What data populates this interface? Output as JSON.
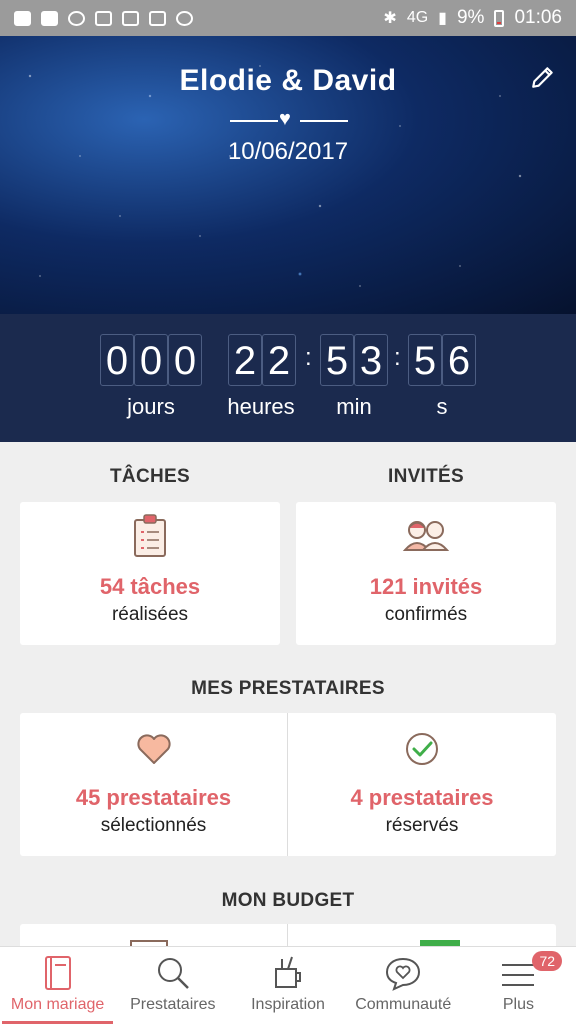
{
  "status_bar": {
    "battery": "9%",
    "time": "01:06",
    "signal": "4G"
  },
  "header": {
    "couple": "Elodie & David",
    "date": "10/06/2017"
  },
  "countdown": {
    "days": [
      "0",
      "0",
      "0"
    ],
    "hours": [
      "2",
      "2"
    ],
    "minutes": [
      "5",
      "3"
    ],
    "seconds": [
      "5",
      "6"
    ],
    "labels": {
      "days": "jours",
      "hours": "heures",
      "minutes": "min",
      "seconds": "s"
    }
  },
  "sections": {
    "tasks": {
      "title": "TÂCHES",
      "count": "54 tâches",
      "sub": "réalisées"
    },
    "guests": {
      "title": "INVITÉS",
      "count": "121 invités",
      "sub": "confirmés"
    },
    "vendors": {
      "title": "MES PRESTATAIRES",
      "selected": {
        "count": "45 prestataires",
        "sub": "sélectionnés"
      },
      "booked": {
        "count": "4 prestataires",
        "sub": "réservés"
      }
    },
    "budget": {
      "title": "MON BUDGET"
    }
  },
  "nav": {
    "items": [
      {
        "label": "Mon mariage"
      },
      {
        "label": "Prestataires"
      },
      {
        "label": "Inspiration"
      },
      {
        "label": "Communauté"
      },
      {
        "label": "Plus"
      }
    ],
    "badge": "72"
  },
  "colors": {
    "accent": "#e0646a",
    "countdown_bg": "#1b2a4e"
  }
}
